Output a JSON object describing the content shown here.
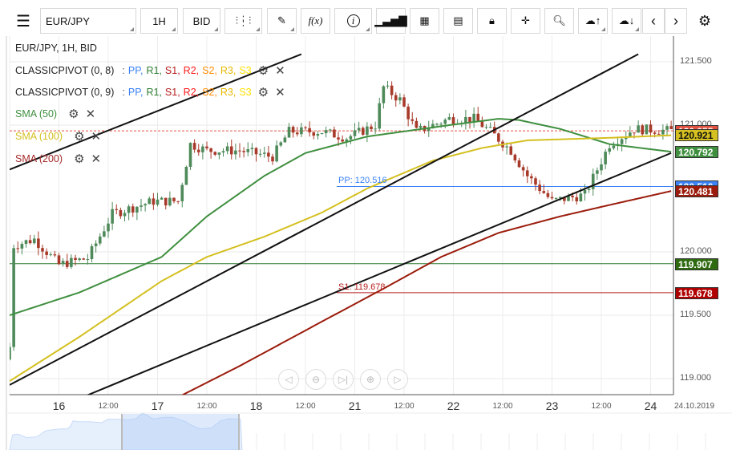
{
  "toolbar": {
    "symbol": "EUR/JPY",
    "interval": "1H",
    "price_type": "BID",
    "items": [
      "menu-icon",
      "candles-icon",
      "draw-icon",
      "function-icon",
      "info-icon",
      "volume-icon",
      "calendar-icon",
      "report-icon",
      "lock-icon",
      "crosshair-icon",
      "zoom-icon",
      "upload-icon",
      "download-icon",
      "prev-icon",
      "next-icon",
      "settings-icon"
    ],
    "fx_label": "f(x)",
    "info_label": "i"
  },
  "legend": {
    "title": "EUR/JPY, 1H, BID",
    "pivots": [
      {
        "name": "CLASSICPIVOT (0, 8)"
      },
      {
        "name": "CLASSICPIVOT (0, 9)"
      }
    ],
    "pivot_parts": [
      {
        "t": "PP",
        "c": "#3b82f6"
      },
      {
        "t": "R1",
        "c": "#2e7d32"
      },
      {
        "t": "S1",
        "c": "#b71c1c"
      },
      {
        "t": "R2",
        "c": "#ff1a1a"
      },
      {
        "t": "S2",
        "c": "#ff8c00"
      },
      {
        "t": "R3",
        "c": "#e6b800"
      },
      {
        "t": "S3",
        "c": "#ffe000"
      }
    ],
    "sep": " : ",
    "smas": [
      {
        "name": "SMA (50)",
        "color": "#3f8f3f"
      },
      {
        "name": "SMA (100)",
        "color": "#d4c020"
      },
      {
        "name": "SMA (200)",
        "color": "#a52a2a"
      }
    ]
  },
  "y_axis": {
    "ticks": [
      {
        "v": 121.5,
        "l": "121.500"
      },
      {
        "v": 121.0,
        "l": "121.000"
      },
      {
        "v": 120.0,
        "l": "120.000"
      },
      {
        "v": 119.5,
        "l": "119.500"
      },
      {
        "v": 119.0,
        "l": "119.000"
      }
    ]
  },
  "x_axis": {
    "labels": [
      {
        "h": 12,
        "l": "16",
        "big": true
      },
      {
        "h": 24,
        "l": "12:00"
      },
      {
        "h": 36,
        "l": "17",
        "big": true
      },
      {
        "h": 48,
        "l": "12:00"
      },
      {
        "h": 60,
        "l": "18",
        "big": true
      },
      {
        "h": 72,
        "l": "12:00"
      },
      {
        "h": 84,
        "l": "21",
        "big": true
      },
      {
        "h": 96,
        "l": "12:00"
      },
      {
        "h": 108,
        "l": "22",
        "big": true
      },
      {
        "h": 120,
        "l": "12:00"
      },
      {
        "h": 132,
        "l": "23",
        "big": true
      },
      {
        "h": 144,
        "l": "12:00"
      },
      {
        "h": 156,
        "l": "24",
        "big": true
      }
    ],
    "date": "24.10.2019"
  },
  "price_labels": [
    {
      "v": 120.955,
      "l": "120.955",
      "bg": "#e05040"
    },
    {
      "v": 120.516,
      "l": "120.516",
      "bg": "#3b82f6"
    },
    {
      "v": 120.921,
      "l": "120.921",
      "bg": "#d4c020",
      "fg": "#111"
    },
    {
      "v": 120.792,
      "l": "120.792",
      "bg": "#3f8f3f"
    },
    {
      "v": 120.481,
      "l": "120.481",
      "bg": "#9b1c0c"
    },
    {
      "v": 119.907,
      "l": "119.907",
      "bg": "#2e6b10"
    },
    {
      "v": 119.678,
      "l": "119.678",
      "bg": "#b00000"
    }
  ],
  "pivot_lines": {
    "pp": {
      "label": "PP: 120.516",
      "v": 120.516,
      "color": "#3b82f6"
    },
    "s1": {
      "label": "S1: 119.678",
      "v": 119.678,
      "color": "#b71c1c"
    },
    "r1": {
      "v": 119.907,
      "color": "#2e7d32"
    },
    "last": {
      "v": 120.955,
      "color": "#e05040"
    }
  },
  "price_keypoints": [
    [
      0,
      119.25
    ],
    [
      1,
      120.05
    ],
    [
      6,
      120.1
    ],
    [
      12,
      119.9
    ],
    [
      19,
      119.95
    ],
    [
      25,
      120.3
    ],
    [
      35,
      120.4
    ],
    [
      41,
      120.4
    ],
    [
      44,
      120.85
    ],
    [
      48,
      120.8
    ],
    [
      56,
      120.8
    ],
    [
      64,
      120.75
    ],
    [
      68,
      120.95
    ],
    [
      76,
      120.95
    ],
    [
      82,
      120.9
    ],
    [
      89,
      121.0
    ],
    [
      91,
      121.3
    ],
    [
      95,
      121.2
    ],
    [
      99,
      120.95
    ],
    [
      107,
      121.05
    ],
    [
      113,
      121.05
    ],
    [
      117,
      120.95
    ],
    [
      122,
      120.8
    ],
    [
      126,
      120.6
    ],
    [
      132,
      120.4
    ],
    [
      140,
      120.45
    ],
    [
      146,
      120.85
    ],
    [
      152,
      120.97
    ],
    [
      161,
      120.955
    ]
  ],
  "sma": [
    {
      "color": "#3f8f3f",
      "pts": [
        [
          0,
          119.5
        ],
        [
          17,
          119.68
        ],
        [
          37,
          119.96
        ],
        [
          48,
          120.28
        ],
        [
          62,
          120.6
        ],
        [
          72,
          120.78
        ],
        [
          87,
          120.91
        ],
        [
          107,
          121.0
        ],
        [
          119,
          121.05
        ],
        [
          124,
          121.04
        ],
        [
          134,
          120.97
        ],
        [
          146,
          120.85
        ],
        [
          161,
          120.79
        ]
      ]
    },
    {
      "color": "#d4c020",
      "pts": [
        [
          0,
          118.98
        ],
        [
          17,
          119.33
        ],
        [
          37,
          119.77
        ],
        [
          48,
          119.96
        ],
        [
          62,
          120.12
        ],
        [
          76,
          120.31
        ],
        [
          87,
          120.5
        ],
        [
          103,
          120.72
        ],
        [
          115,
          120.82
        ],
        [
          126,
          120.88
        ],
        [
          146,
          120.9
        ],
        [
          161,
          120.92
        ]
      ]
    },
    {
      "color": "#9b1c0c",
      "pts": [
        [
          42,
          118.87
        ],
        [
          56,
          119.1
        ],
        [
          76,
          119.45
        ],
        [
          91,
          119.71
        ],
        [
          105,
          119.96
        ],
        [
          119,
          120.15
        ],
        [
          134,
          120.28
        ],
        [
          146,
          120.37
        ],
        [
          161,
          120.48
        ]
      ]
    }
  ],
  "trendlines": [
    [
      [
        0,
        118.95
      ],
      [
        153,
        121.56
      ]
    ],
    [
      [
        0,
        120.65
      ],
      [
        71,
        121.56
      ]
    ],
    [
      [
        19,
        118.87
      ],
      [
        161,
        120.78
      ]
    ]
  ]
}
